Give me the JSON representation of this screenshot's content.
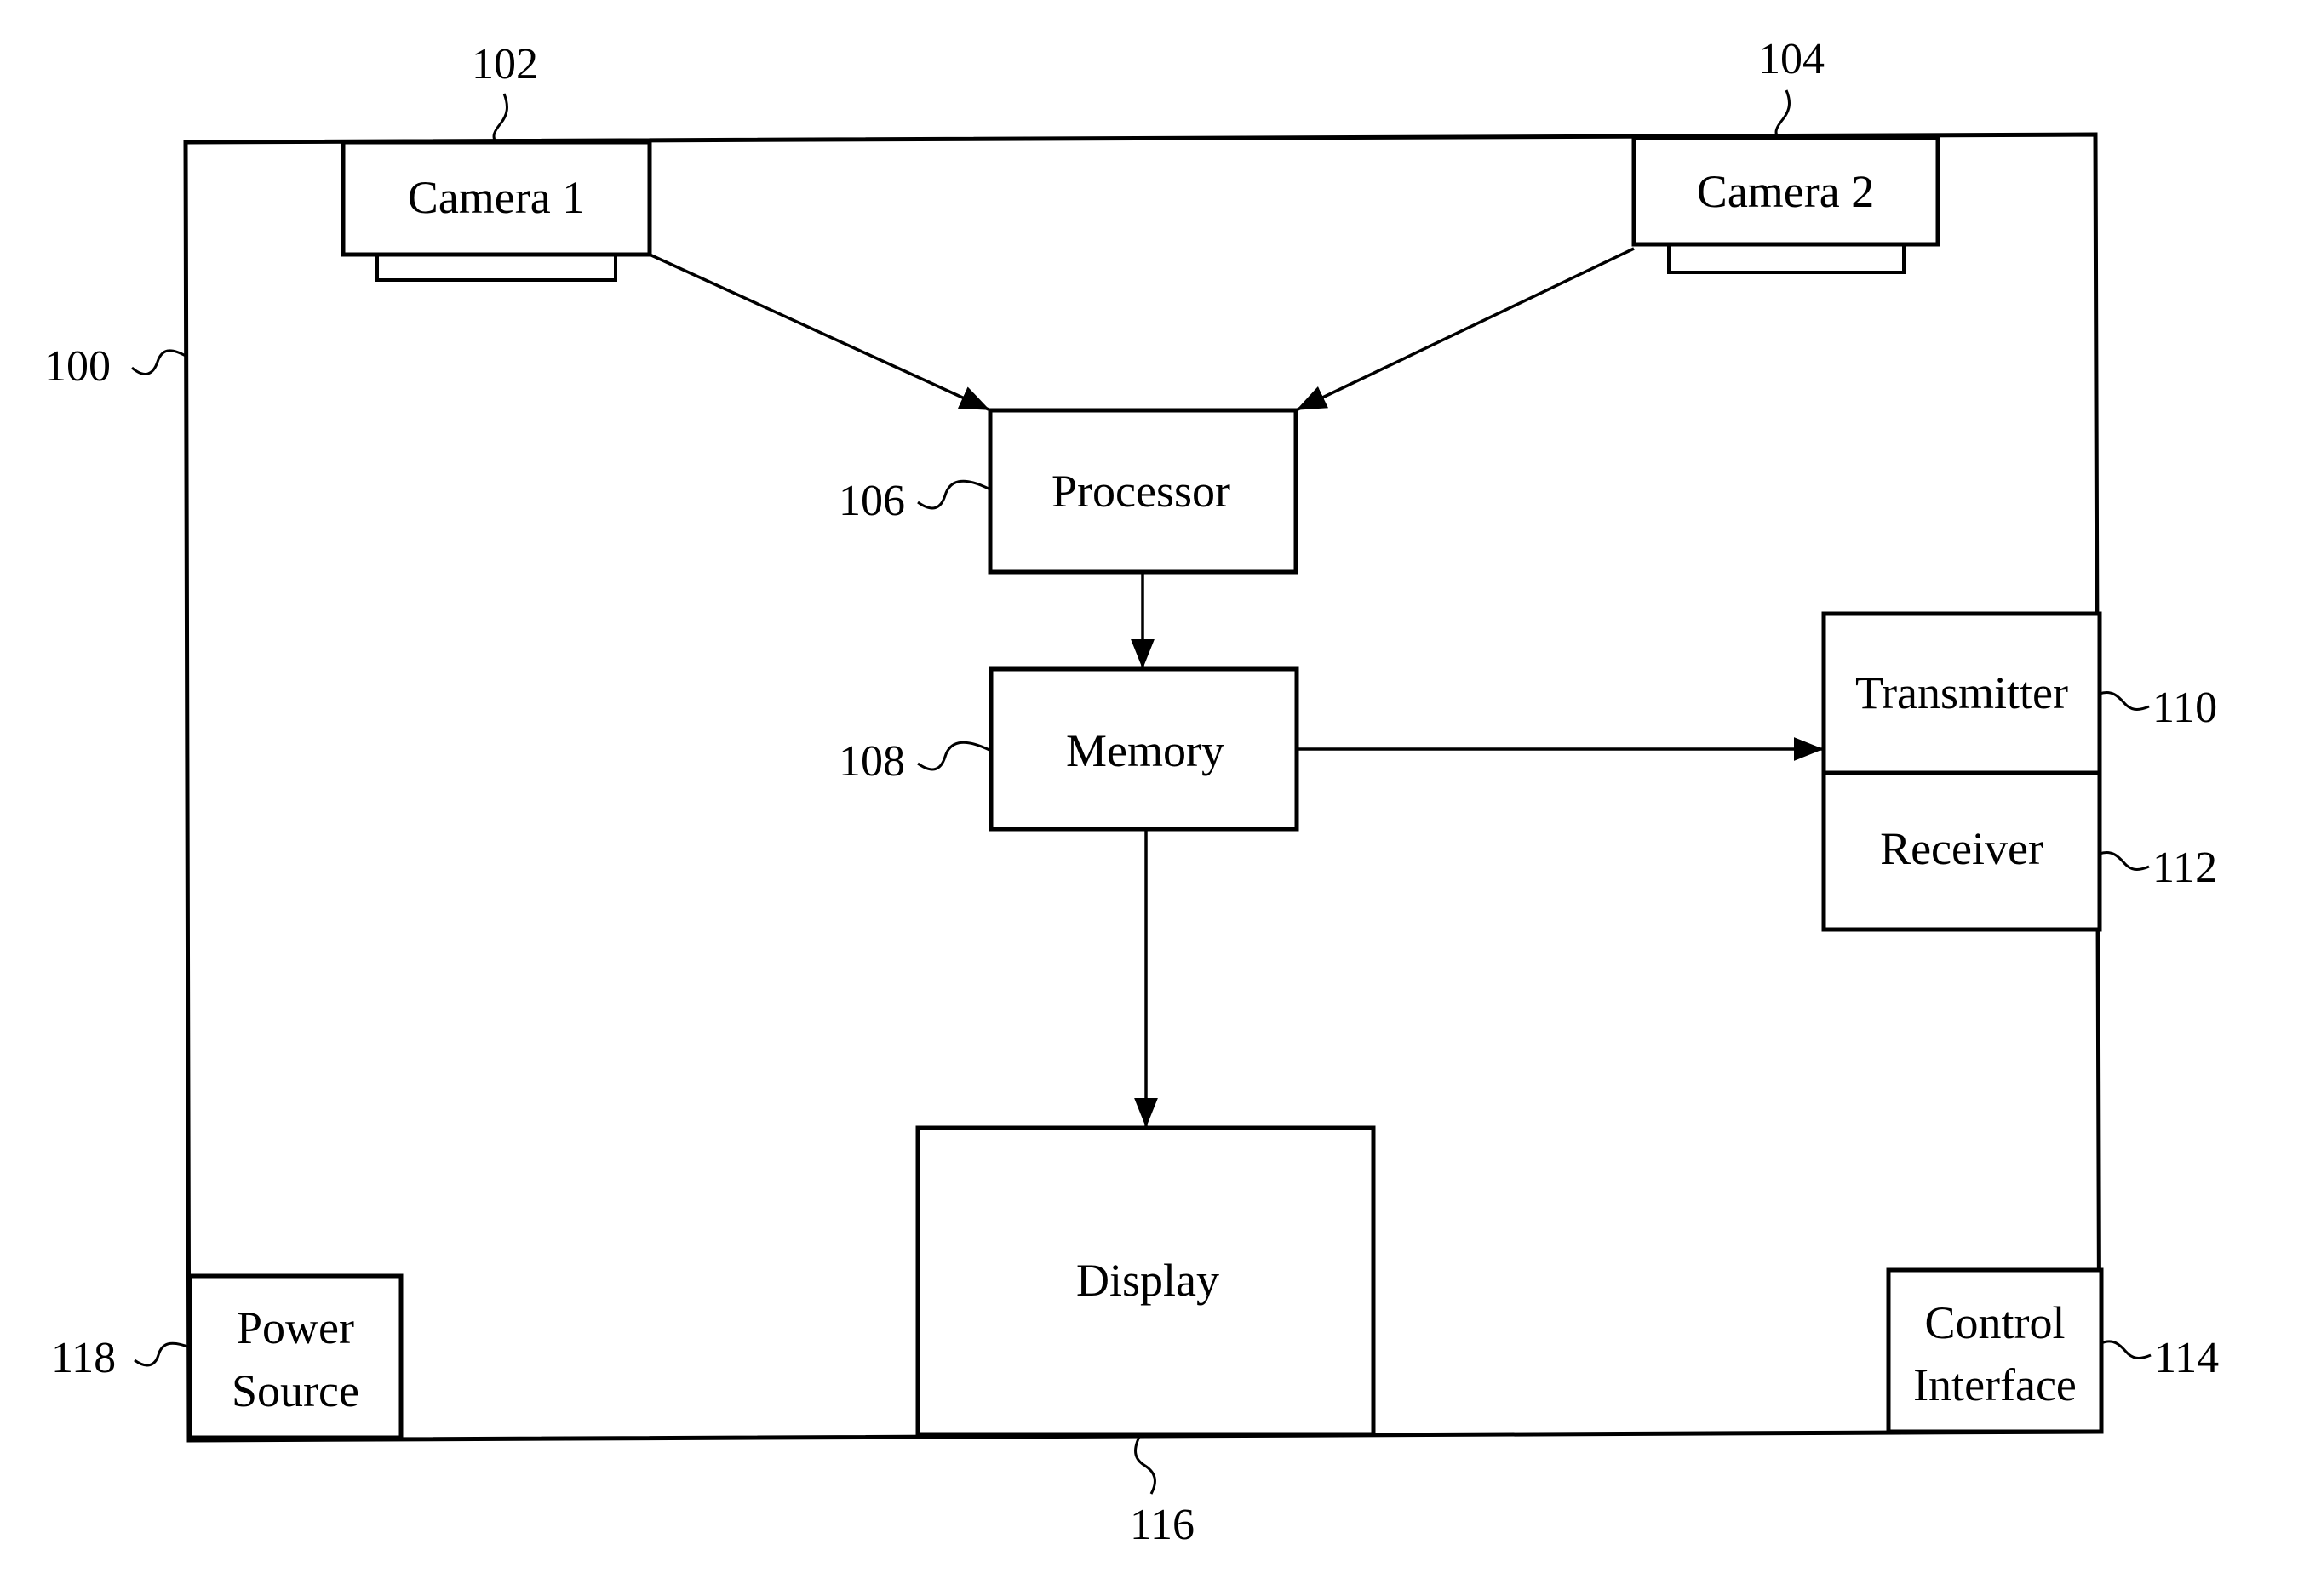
{
  "diagram": {
    "type": "block-diagram",
    "device": {
      "ref": "100"
    },
    "components": [
      {
        "id": "camera1",
        "label": "Camera 1",
        "ref": "102"
      },
      {
        "id": "camera2",
        "label": "Camera 2",
        "ref": "104"
      },
      {
        "id": "processor",
        "label": "Processor",
        "ref": "106"
      },
      {
        "id": "memory",
        "label": "Memory",
        "ref": "108"
      },
      {
        "id": "transmitter",
        "label": "Transmitter",
        "ref": "110"
      },
      {
        "id": "receiver",
        "label": "Receiver",
        "ref": "112"
      },
      {
        "id": "control_interface",
        "label_lines": [
          "Control",
          "Interface"
        ],
        "ref": "114"
      },
      {
        "id": "display",
        "label": "Display",
        "ref": "116"
      },
      {
        "id": "power_source",
        "label_lines": [
          "Power",
          "Source"
        ],
        "ref": "118"
      }
    ],
    "connections": [
      {
        "from": "camera1",
        "to": "processor"
      },
      {
        "from": "camera2",
        "to": "processor"
      },
      {
        "from": "processor",
        "to": "memory"
      },
      {
        "from": "memory",
        "to": "transmitter"
      },
      {
        "from": "memory",
        "to": "display"
      }
    ]
  }
}
